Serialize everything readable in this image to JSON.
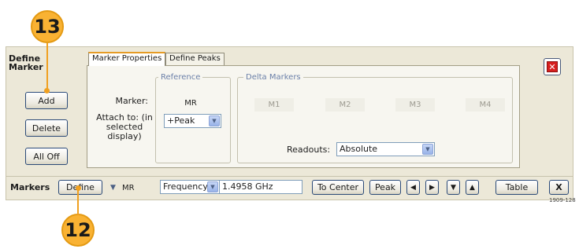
{
  "callouts": {
    "top": "13",
    "bottom": "12"
  },
  "define_marker": {
    "title": "Define Marker",
    "buttons": {
      "add": "Add",
      "delete": "Delete",
      "all_off": "All Off"
    },
    "tabs": [
      {
        "label": "Marker Properties",
        "active": true
      },
      {
        "label": "Define Peaks",
        "active": false
      }
    ],
    "reference": {
      "group_label": "Reference",
      "marker_label": "Marker:",
      "marker_value": "MR",
      "attach_label": "Attach to: (in selected display)",
      "attach_value": "+Peak"
    },
    "delta": {
      "group_label": "Delta Markers",
      "markers": [
        "M1",
        "M2",
        "M3",
        "M4"
      ],
      "readouts_label": "Readouts:",
      "readouts_value": "Absolute"
    }
  },
  "markers_bar": {
    "label": "Markers",
    "define_button": "Define",
    "selected_marker": "MR",
    "readout_type": "Frequency",
    "frequency_value": "1.4958 GHz",
    "to_center": "To Center",
    "peak": "Peak",
    "arrow_icons": [
      "arrow-left-icon",
      "arrow-right-icon",
      "arrow-down-icon",
      "arrow-up-icon"
    ],
    "table": "Table",
    "close": "X"
  },
  "figure_id": "1909-128",
  "colors": {
    "callout": "#f9b233",
    "panel": "#ece8d8",
    "tab_accent": "#e59b25",
    "close_red": "#d61f1f"
  }
}
